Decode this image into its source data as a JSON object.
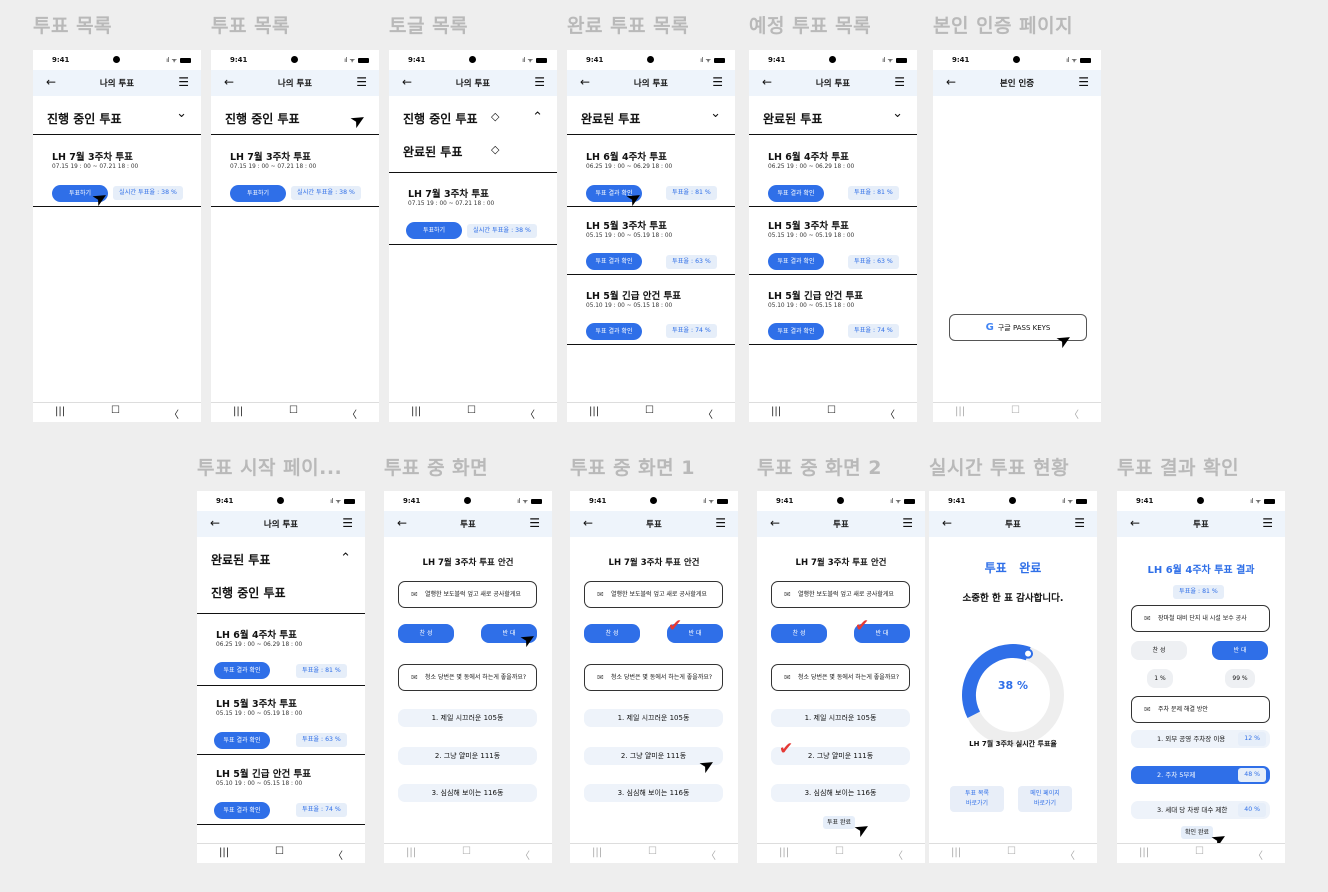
{
  "screens": {
    "s1": {
      "label": "투표 목록"
    },
    "s2": {
      "label": "투표 목록"
    },
    "s3": {
      "label": "토글 목록"
    },
    "s4": {
      "label": "완료 투표 목록"
    },
    "s5": {
      "label": "예정 투표 목록"
    },
    "s6": {
      "label": "본인 인증 페이지"
    },
    "s7": {
      "label": "투표 시작 페이..."
    },
    "s8": {
      "label": "투표 중 화면"
    },
    "s9": {
      "label": "투표 중 화면 1"
    },
    "s10": {
      "label": "투표 중 화면 2"
    },
    "s11": {
      "label": "실시간 투표 현황"
    },
    "s12": {
      "label": "투표 결과 확인"
    }
  },
  "common": {
    "time": "9:41",
    "my_votes": "나의 투표",
    "vote": "투표",
    "auth_title": "본인 인증",
    "back": "←",
    "menu": "☰",
    "chev_down": "⌄",
    "chev_up": "⌃",
    "nav1": "|||",
    "nav2": "☐",
    "nav3": "〈"
  },
  "lists": {
    "in_progress": "진행 중인 투표",
    "completed": "완료된 투표",
    "july_title": "LH 7월 3주차 투표",
    "july_date": "07.15 19 : 00 ~ 07.21 18 : 00",
    "vote_btn": "투표하기",
    "realtime_badge": "실시간 투표율 : 38 %",
    "result_btn": "투표 결과 확인",
    "items": [
      {
        "title": "LH 6월 4주차 투표",
        "date": "06.25 19 : 00 ~ 06.29 18 : 00",
        "rate": "투표율 : 81 %"
      },
      {
        "title": "LH 5월 3주차 투표",
        "date": "05.15 19 : 00 ~ 05.19 18 : 00",
        "rate": "투표율 : 63 %"
      },
      {
        "title": "LH 5월 긴급 안건 투표",
        "date": "05.10 19 : 00 ~ 05.15 18 : 00",
        "rate": "투표율 : 74 %"
      }
    ]
  },
  "auth": {
    "google_btn": "구글 PASS KEYS",
    "g": "G"
  },
  "voting": {
    "agenda_title": "LH 7월 3주차 투표 안건",
    "q1": "열행한 보도블럭 엎고 새로 공사할게요",
    "agree": "찬 성",
    "disagree": "반 대",
    "q2": "청소 당번은 몇 동에서 하는게 좋을까요?",
    "opt1": "1. 제일 시끄러운 105동",
    "opt2": "2. 그냥 얄미운 111동",
    "opt3": "3. 심심해 보이는 116동",
    "done_btn": "투표 완료",
    "mail": "✉",
    "check": "✔"
  },
  "realtime": {
    "heading": "투표   완료",
    "thanks": "소중한 한 표 감사합니다.",
    "percent": "38 %",
    "caption": "LH 7월 3주차 실시간 투표율",
    "link1_a": "투표 목록",
    "link1_b": "바로가기",
    "link2_a": "메인 페이지",
    "link2_b": "바로가기",
    "rate_fraction": 0.38
  },
  "result": {
    "title": "LH 6월 4주차 투표 결과",
    "rate": "투표율 : 81 %",
    "q1": "장마철 대비 단지 내 시설 보수 공사",
    "agree": "찬 성",
    "disagree": "반 대",
    "agree_pct": "1 %",
    "disagree_pct": "99 %",
    "q2": "주차 문제 해결 방안",
    "r1": "1. 외부 공영 주차장 이용",
    "r1p": "12 %",
    "r2": "2. 주차 5부제",
    "r2p": "48 %",
    "r3": "3. 세대 당 차량 대수 제한",
    "r3p": "40 %",
    "confirm": "확인 완료"
  },
  "colors": {
    "accent": "#2f6fe8",
    "check": "#e53935",
    "header_bg": "#eef4fb"
  }
}
